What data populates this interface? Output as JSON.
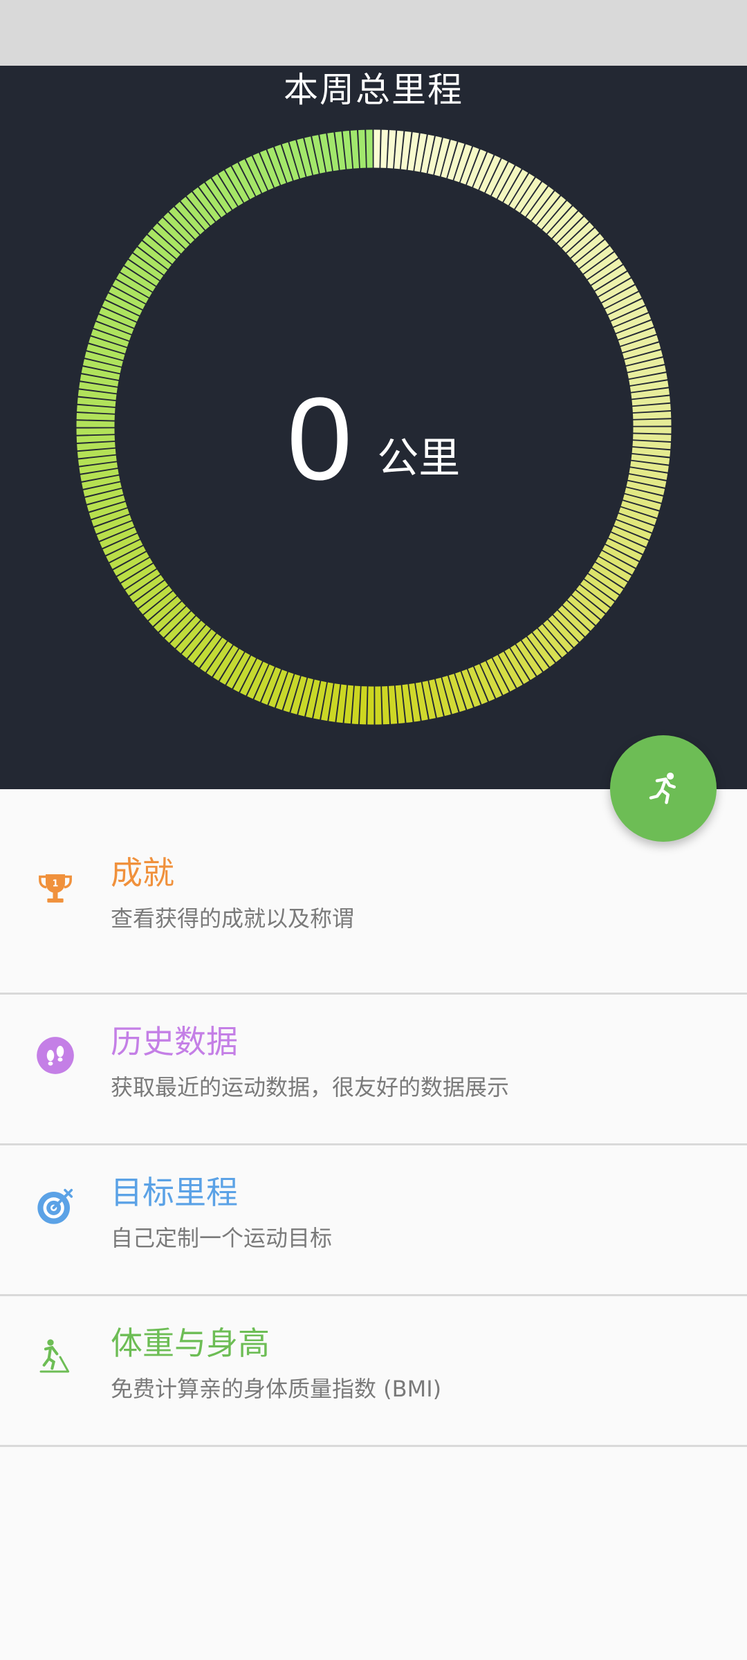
{
  "hero": {
    "title": "本周总里程",
    "distance_value": "0",
    "distance_unit": "公里",
    "background_color": "#232833",
    "ring_start_color": "#a6ea6e",
    "ring_end_color": "#cdd620"
  },
  "fab": {
    "icon": "running-man-icon",
    "color": "#6dbd55"
  },
  "menu": {
    "items": [
      {
        "title": "成就",
        "description": "查看获得的成就以及称谓",
        "icon": "trophy-icon",
        "color": "#f0913c"
      },
      {
        "title": "历史数据",
        "description": "获取最近的运动数据，很友好的数据展示",
        "icon": "footprints-icon",
        "color": "#c47fe6"
      },
      {
        "title": "目标里程",
        "description": "自己定制一个运动目标",
        "icon": "target-icon",
        "color": "#5ba2e6"
      },
      {
        "title": "体重与身高",
        "description": "免费计算亲的身体质量指数 (BMI)",
        "icon": "scale-person-icon",
        "color": "#6dbd55"
      }
    ]
  }
}
